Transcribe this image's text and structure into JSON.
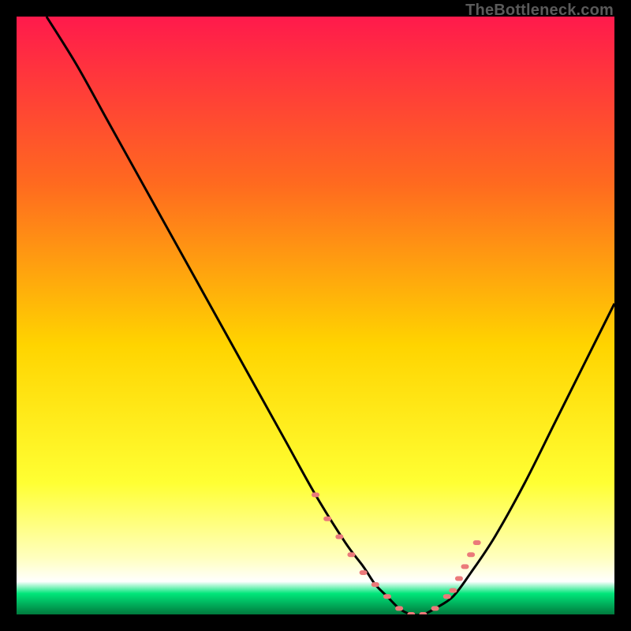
{
  "watermark": "TheBottleneck.com",
  "colors": {
    "bg": "#000000",
    "grad_top": "#ff1a4c",
    "grad_mid1": "#ff6a1f",
    "grad_mid2": "#ffd400",
    "grad_yellow": "#ffff33",
    "grad_cream": "#ffffbe",
    "grad_green": "#00e67a",
    "curve": "#000000",
    "dots": "#eb7a7a"
  },
  "chart_data": {
    "type": "line",
    "title": "",
    "xlabel": "",
    "ylabel": "",
    "xlim": [
      0,
      100
    ],
    "ylim": [
      0,
      100
    ],
    "series": [
      {
        "name": "bottleneck-curve",
        "x": [
          5,
          10,
          15,
          20,
          25,
          30,
          35,
          40,
          45,
          50,
          55,
          58,
          60,
          62,
          64,
          66,
          68,
          70,
          73,
          76,
          80,
          85,
          90,
          95,
          100
        ],
        "y": [
          100,
          92,
          83,
          74,
          65,
          56,
          47,
          38,
          29,
          20,
          12,
          8,
          5,
          3,
          1,
          0,
          0,
          1,
          3,
          7,
          13,
          22,
          32,
          42,
          52
        ]
      }
    ],
    "annotations": {
      "dot_clusters_x": [
        50,
        52,
        54,
        56,
        58,
        60,
        62,
        64,
        66,
        68,
        70,
        72,
        73,
        74,
        75,
        76,
        77
      ],
      "dot_clusters_y": [
        20,
        16,
        13,
        10,
        7,
        5,
        3,
        1,
        0,
        0,
        1,
        3,
        4,
        6,
        8,
        10,
        12
      ]
    }
  }
}
